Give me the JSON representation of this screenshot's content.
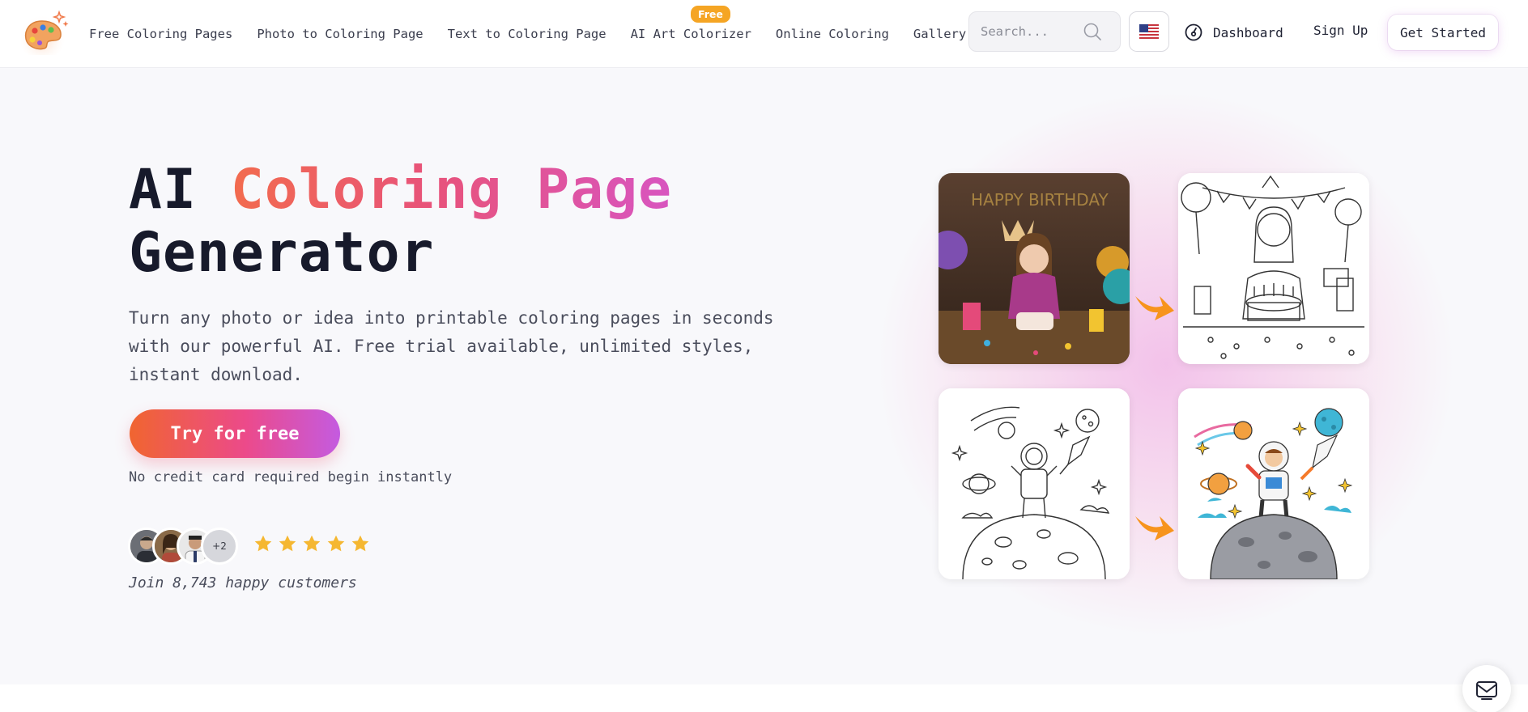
{
  "nav": {
    "items": [
      {
        "label": "Free Coloring Pages"
      },
      {
        "label": "Photo to Coloring Page"
      },
      {
        "label": "Text to Coloring Page"
      },
      {
        "label": "AI Art Colorizer"
      },
      {
        "label": "Online Coloring"
      },
      {
        "label": "Gallery"
      }
    ],
    "free_badge": "Free"
  },
  "search": {
    "placeholder": "Search..."
  },
  "header": {
    "dashboard_label": "Dashboard",
    "signup_label": "Sign Up",
    "get_started_label": "Get Started"
  },
  "hero": {
    "title_prefix": "AI",
    "title_highlight": "Coloring Page",
    "title_suffix": "Generator",
    "subtitle": "Turn any photo or idea into printable coloring pages in seconds with our powerful AI. Free trial available, unlimited styles, instant download.",
    "cta_label": "Try for free",
    "cta_note": "No credit card required begin instantly",
    "avatar_more": "+2",
    "rating_stars": 5,
    "customers_text": "Join 8,743 happy customers"
  },
  "colors": {
    "accent_orange": "#f26b4e",
    "accent_pink": "#e8537a",
    "accent_purple": "#d855c0",
    "star": "#f5b731",
    "arrow": "#f7941d"
  },
  "icons": {
    "logo": "palette-icon",
    "search": "search-icon",
    "language": "us-flag-icon",
    "dashboard": "dashboard-gauge-icon",
    "mail": "mail-icon"
  }
}
